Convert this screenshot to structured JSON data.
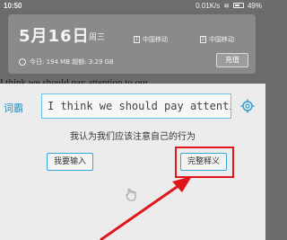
{
  "status_bar": {
    "time": "10:50",
    "net_speed": "0.01K/s",
    "battery": "49%"
  },
  "notification": {
    "date": "5月16日",
    "weekday": "周三",
    "sim1": "中国移动",
    "sim2": "中国移动",
    "data_usage": "今日: 194 MB  超额: 3.29 GB",
    "recharge": "充值"
  },
  "background_sentence": "I think we should pay attention to our",
  "dictionary": {
    "logo_text": "词霸",
    "input_value": "I think we should pay attention",
    "translation": "我认为我们应该注意自己的行为",
    "input_button": "我要输入",
    "full_button": "完整释义"
  },
  "colors": {
    "accent": "#35a7d9",
    "highlight": "#e0161b"
  },
  "icons": [
    "wifi-icon",
    "battery-icon",
    "sim-card-icon",
    "data-usage-icon",
    "settings-gear-icon",
    "hand-icon",
    "red-arrow-icon"
  ]
}
